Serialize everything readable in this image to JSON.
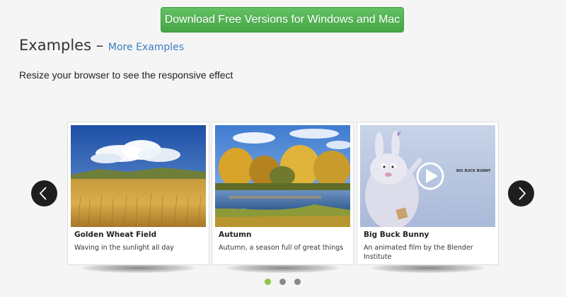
{
  "download_button": {
    "label": "Download Free Versions for Windows and Mac"
  },
  "section": {
    "title": "Examples – ",
    "more_link": "More Examples"
  },
  "hint": "Resize your browser to see the responsive effect",
  "carousel": {
    "slides": [
      {
        "title": "Golden Wheat Field",
        "description": "Waving in the sunlight all day"
      },
      {
        "title": "Autumn",
        "description": "Autumn, a season full of great things"
      },
      {
        "title": "Big Buck Bunny",
        "description": "An animated film by the Blender Institute",
        "video_caption": "BIG BUCK BUNNY"
      }
    ],
    "pagination": {
      "count": 3,
      "active_index": 0
    }
  },
  "colors": {
    "download_green": "#4cae4c",
    "link_blue": "#3a7fc1",
    "active_dot": "#8dc63f",
    "inactive_dot": "#888888",
    "nav_button": "#1e1e1e"
  },
  "icons": {
    "prev": "chevron-left-icon",
    "next": "chevron-right-icon",
    "play": "play-icon"
  }
}
